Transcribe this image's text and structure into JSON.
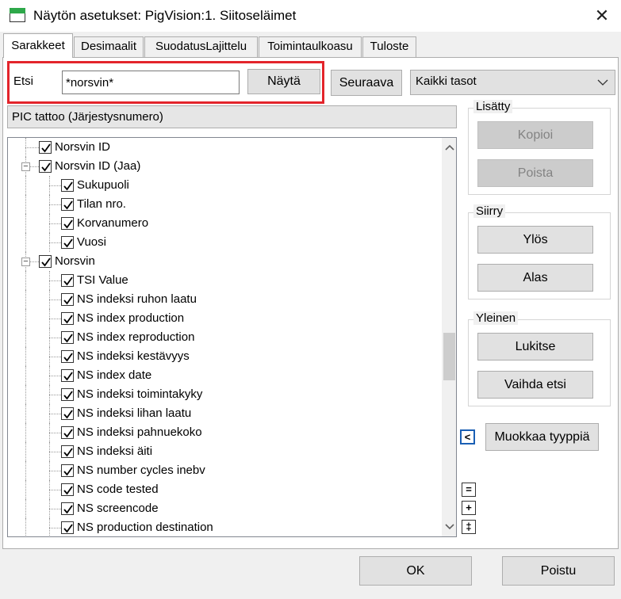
{
  "window": {
    "title": "Näytön asetukset: PigVision:1. Siitoseläimet",
    "close_glyph": "✕"
  },
  "tabs": [
    {
      "label": "Sarakkeet",
      "active": true
    },
    {
      "label": "Desimaalit"
    },
    {
      "label": "SuodatusLajittelu"
    },
    {
      "label": "Toimintaulkoasu"
    },
    {
      "label": "Tuloste"
    }
  ],
  "search": {
    "label": "Etsi",
    "value": "*norsvin*",
    "show_button": "Näytä",
    "next_button": "Seuraava",
    "level_select": "Kaikki tasot"
  },
  "selected_field": "PIC tattoo (Järjestysnumero)",
  "tree": [
    {
      "label": "Norsvin ID",
      "level": 1,
      "checked": true
    },
    {
      "label": "Norsvin ID (Jaa)",
      "level": 1,
      "checked": true,
      "expander": "−"
    },
    {
      "label": "Sukupuoli",
      "level": 2,
      "checked": true
    },
    {
      "label": "Tilan nro.",
      "level": 2,
      "checked": true
    },
    {
      "label": "Korvanumero",
      "level": 2,
      "checked": true
    },
    {
      "label": "Vuosi",
      "level": 2,
      "checked": true
    },
    {
      "label": "Norsvin",
      "level": 1,
      "checked": true,
      "expander": "−"
    },
    {
      "label": "TSI Value",
      "level": 2,
      "checked": true
    },
    {
      "label": "NS indeksi ruhon laatu",
      "level": 2,
      "checked": true
    },
    {
      "label": "NS index production",
      "level": 2,
      "checked": true
    },
    {
      "label": "NS index reproduction",
      "level": 2,
      "checked": true
    },
    {
      "label": "NS indeksi kestävyys",
      "level": 2,
      "checked": true
    },
    {
      "label": "NS index date",
      "level": 2,
      "checked": true
    },
    {
      "label": "NS indeksi toimintakyky",
      "level": 2,
      "checked": true
    },
    {
      "label": "NS indeksi lihan laatu",
      "level": 2,
      "checked": true
    },
    {
      "label": "NS indeksi pahnuekoko",
      "level": 2,
      "checked": true
    },
    {
      "label": "NS indeksi äiti",
      "level": 2,
      "checked": true
    },
    {
      "label": "NS number cycles inebv",
      "level": 2,
      "checked": true
    },
    {
      "label": "NS code tested",
      "level": 2,
      "checked": true
    },
    {
      "label": "NS screencode",
      "level": 2,
      "checked": true
    },
    {
      "label": "NS production destination",
      "level": 2,
      "checked": true
    }
  ],
  "groups": {
    "added": {
      "title": "Lisätty",
      "copy": "Kopioi",
      "remove": "Poista"
    },
    "move": {
      "title": "Siirry",
      "up": "Ylös",
      "down": "Alas"
    },
    "general": {
      "title": "Yleinen",
      "lock": "Lukitse",
      "switch_search": "Vaihda etsi"
    }
  },
  "side": {
    "collapse_glyph": "<",
    "edit_type": "Muokkaa tyyppiä",
    "eq_glyph": "=",
    "plus_glyph": "+",
    "dbl_glyph": "‡"
  },
  "footer": {
    "ok": "OK",
    "exit": "Poistu"
  }
}
